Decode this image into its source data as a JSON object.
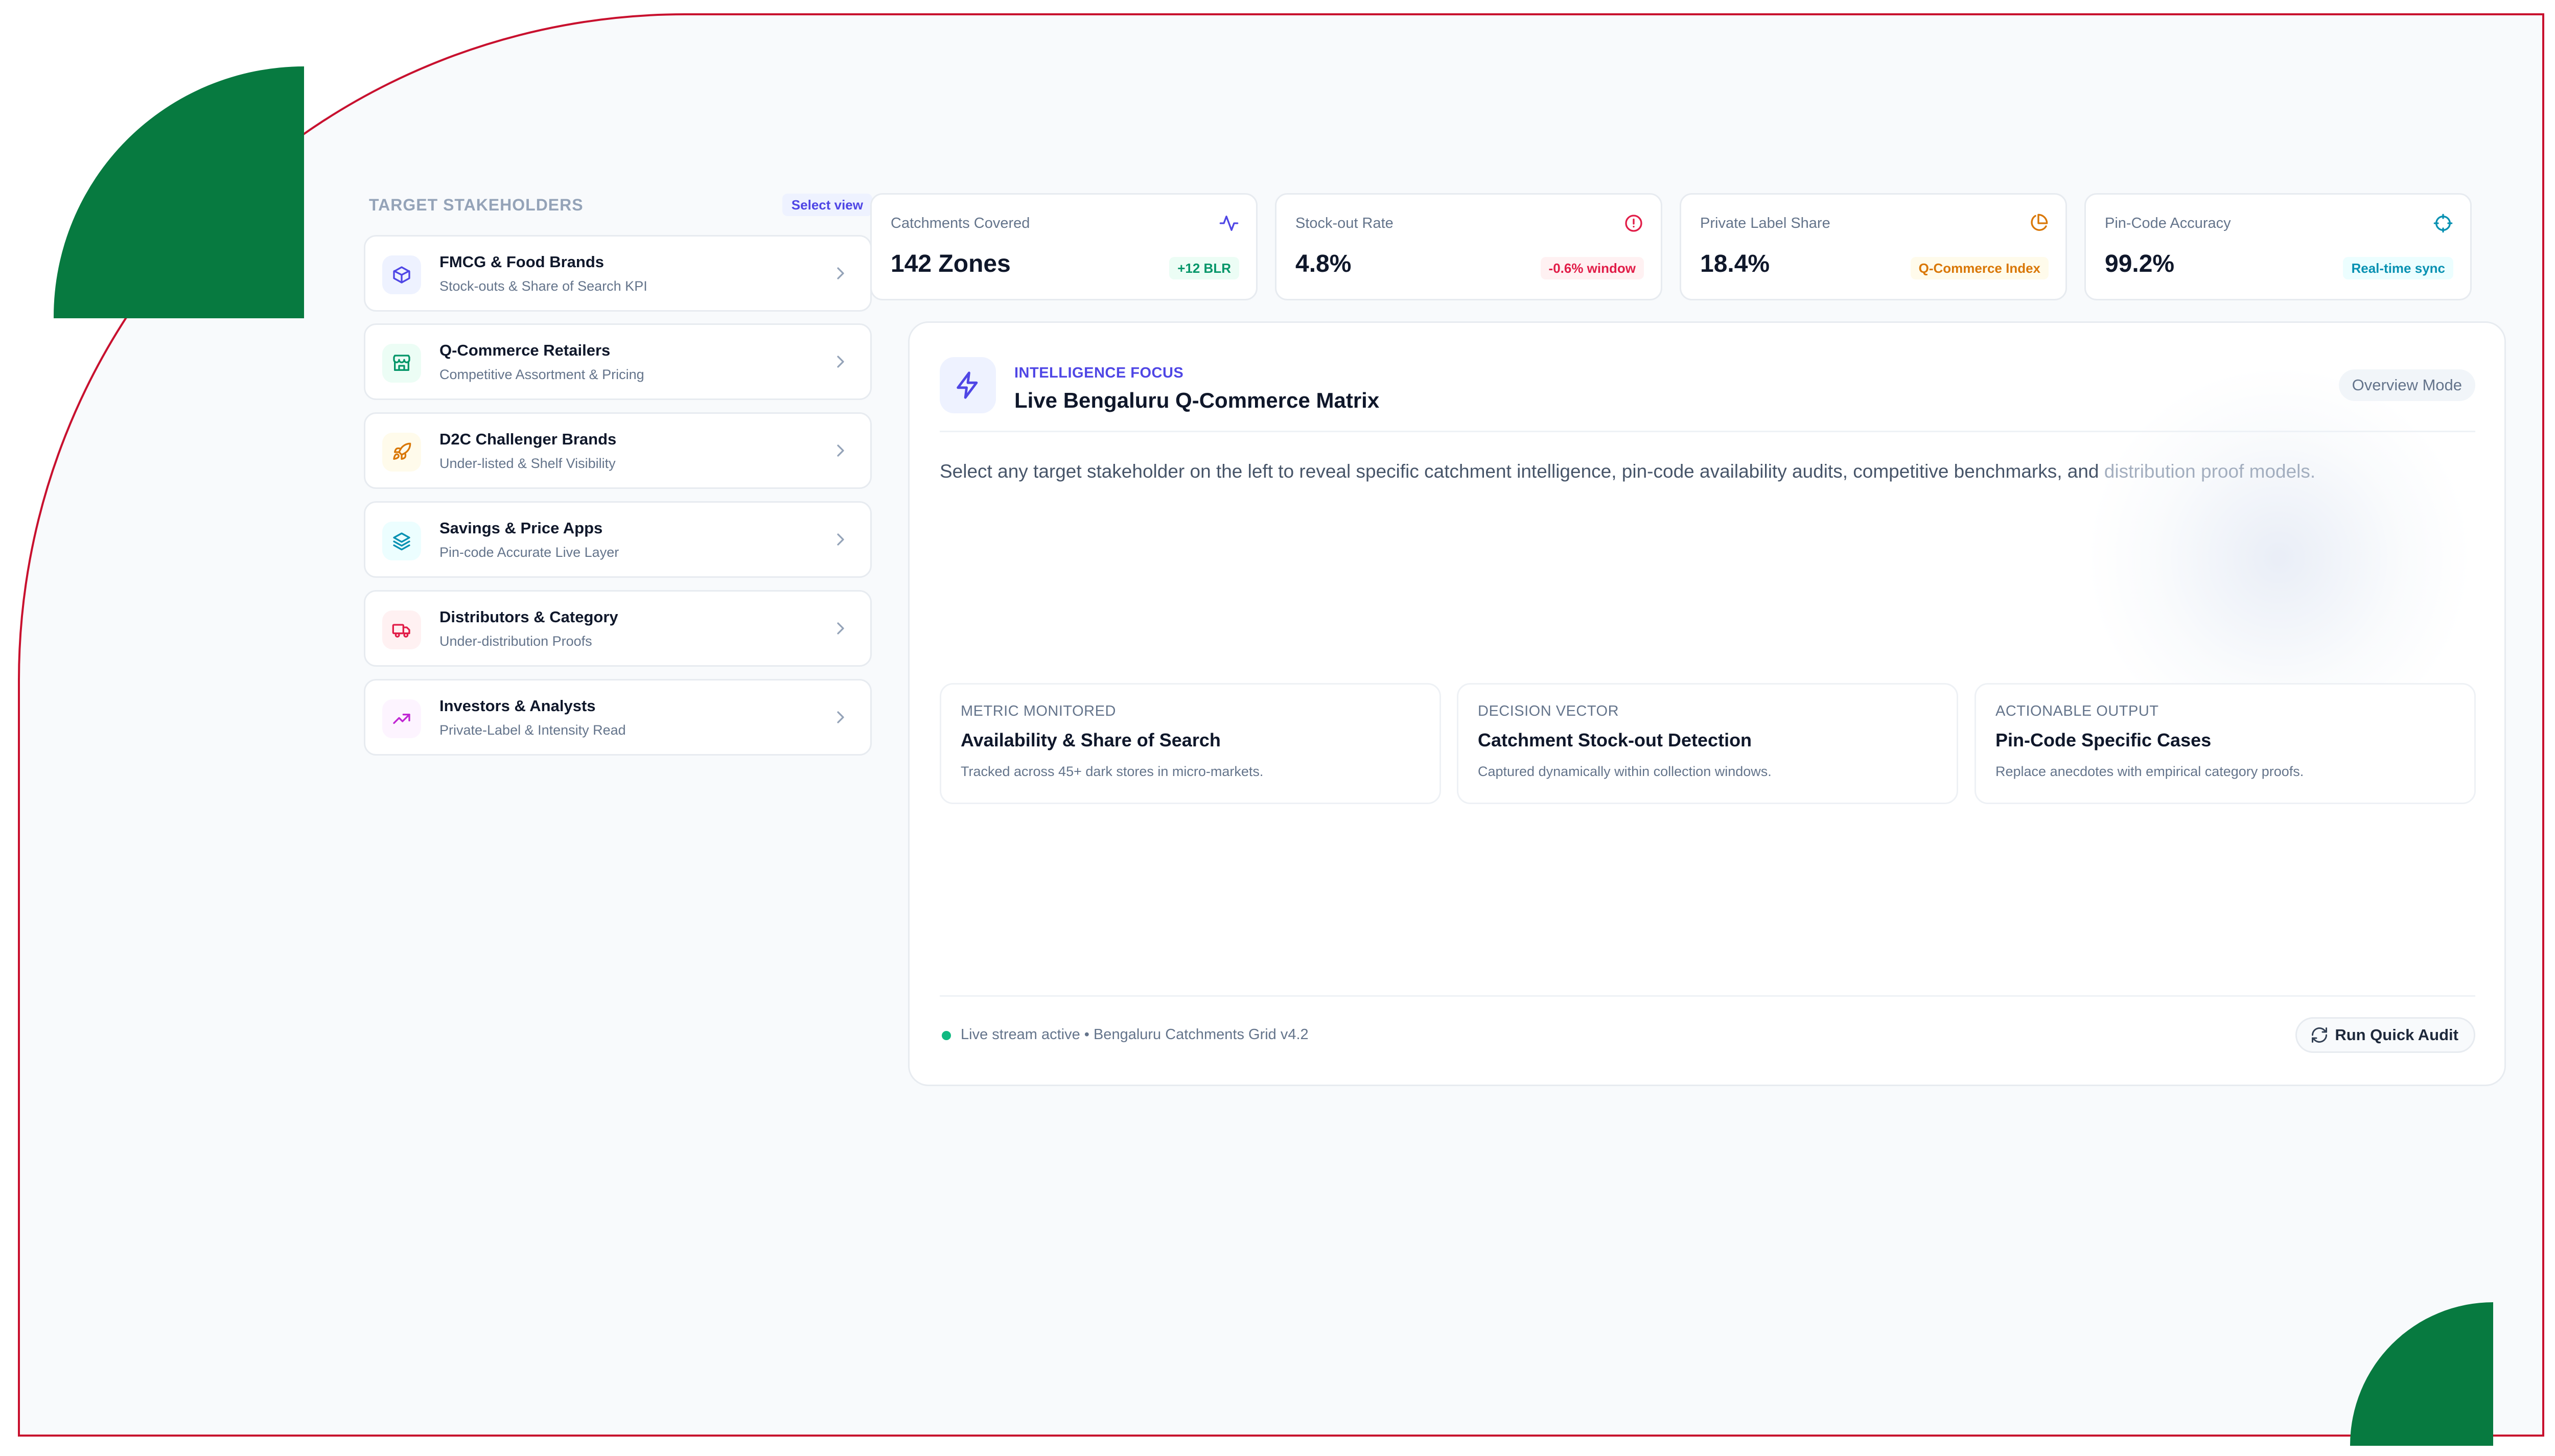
{
  "sidebar": {
    "title": "TARGET STAKEHOLDERS",
    "select_label": "Select view",
    "items": [
      {
        "name": "FMCG & Food Brands",
        "desc": "Stock-outs & Share of Search KPI",
        "icon": "box-icon",
        "color": "#4f46e5",
        "bg": "#eef2ff"
      },
      {
        "name": "Q-Commerce Retailers",
        "desc": "Competitive Assortment & Pricing",
        "icon": "store-icon",
        "color": "#059669",
        "bg": "#ecfdf5"
      },
      {
        "name": "D2C Challenger Brands",
        "desc": "Under-listed & Shelf Visibility",
        "icon": "rocket-icon",
        "color": "#d97706",
        "bg": "#fffbeb"
      },
      {
        "name": "Savings & Price Apps",
        "desc": "Pin-code Accurate Live Layer",
        "icon": "layers-icon",
        "color": "#0891b2",
        "bg": "#ecfeff"
      },
      {
        "name": "Distributors & Category",
        "desc": "Under-distribution Proofs",
        "icon": "truck-icon",
        "color": "#e11d48",
        "bg": "#fff1f2"
      },
      {
        "name": "Investors & Analysts",
        "desc": "Private-Label & Intensity Read",
        "icon": "trending-up-icon",
        "color": "#c026d3",
        "bg": "#fdf4ff"
      }
    ]
  },
  "kpis": [
    {
      "label": "Catchments Covered",
      "value": "142 Zones",
      "badge": "+12 BLR",
      "icon": "activity-icon",
      "icon_color": "#4f46e5",
      "badge_color": "#059669",
      "badge_bg": "#ecfdf5"
    },
    {
      "label": "Stock-out Rate",
      "value": "4.8%",
      "badge": "-0.6% window",
      "icon": "alert-circle-icon",
      "icon_color": "#e11d48",
      "badge_color": "#e11d48",
      "badge_bg": "#fff1f2"
    },
    {
      "label": "Private Label Share",
      "value": "18.4%",
      "badge": "Q-Commerce Index",
      "icon": "pie-chart-icon",
      "icon_color": "#d97706",
      "badge_color": "#d97706",
      "badge_bg": "#fffbeb"
    },
    {
      "label": "Pin-Code Accuracy",
      "value": "99.2%",
      "badge": "Real-time sync",
      "icon": "crosshair-icon",
      "icon_color": "#0891b2",
      "badge_color": "#0891b2",
      "badge_bg": "#ecfeff"
    }
  ],
  "focus": {
    "label": "INTELLIGENCE FOCUS",
    "title": "Live Bengaluru Q-Commerce Matrix",
    "mode": "Overview Mode",
    "desc_main": "Select any target stakeholder on the left to reveal specific catchment intelligence, pin-code availability audits, competitive benchmarks, and ",
    "desc_fade": "distribution proof models.",
    "cards": [
      {
        "label": "METRIC MONITORED",
        "title": "Availability & Share of Search",
        "desc": "Tracked across 45+ dark stores in micro-markets."
      },
      {
        "label": "DECISION VECTOR",
        "title": "Catchment Stock-out Detection",
        "desc": "Captured dynamically within collection windows."
      },
      {
        "label": "ACTIONABLE OUTPUT",
        "title": "Pin-Code Specific Cases",
        "desc": "Replace anecdotes with empirical category proofs."
      }
    ],
    "status": "Live stream active • Bengaluru Catchments Grid v4.2",
    "audit_label": "Run Quick Audit"
  },
  "colors": {
    "brand_green": "#077a40",
    "frame_red": "#c8102e",
    "accent": "#4f46e5"
  }
}
